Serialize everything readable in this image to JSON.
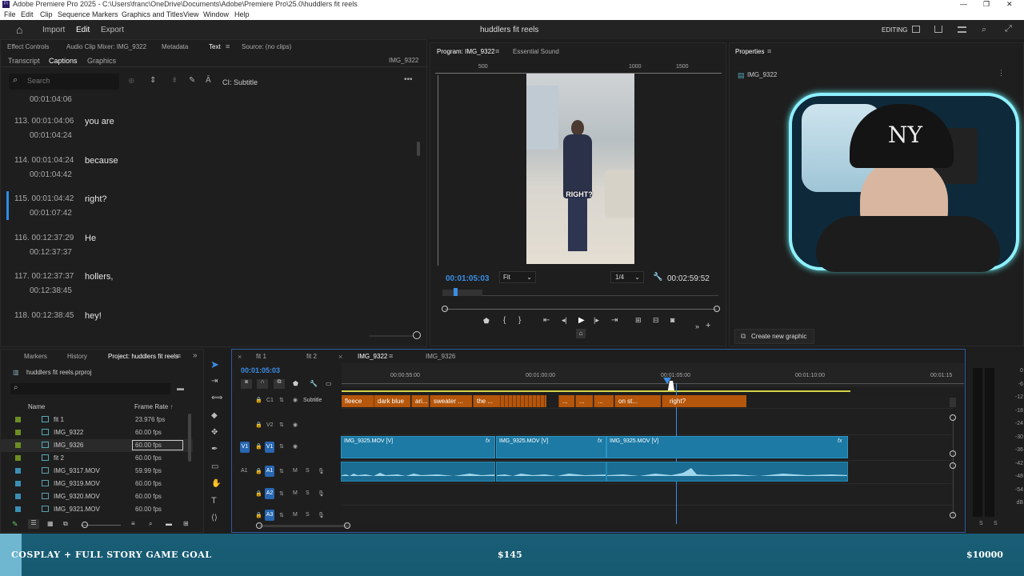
{
  "window": {
    "title": "Adobe Premiere Pro 2025 - C:\\Users\\franc\\OneDrive\\Documents\\Adobe\\Premiere Pro\\25.0\\huddlers fit reels",
    "min": "—",
    "max": "❐",
    "close": "✕"
  },
  "menu": [
    "File",
    "Edit",
    "Clip",
    "Sequence",
    "Markers",
    "Graphics and Titles",
    "View",
    "Window",
    "Help"
  ],
  "header": {
    "home": "⌂",
    "nav": [
      "Import",
      "Edit",
      "Export"
    ],
    "active": "Edit",
    "project_name": "huddlers fit reels",
    "workspace": "EDITING"
  },
  "left_panel": {
    "tabs": [
      "Effect Controls",
      "Audio Clip Mixer: IMG_9322",
      "Metadata",
      "Text",
      "Source: (no clips)"
    ],
    "active_tab": "Text",
    "subtabs": [
      "Transcript",
      "Captions",
      "Graphics"
    ],
    "active_subtab": "Captions",
    "clip_name": "IMG_9322",
    "search_placeholder": "Search",
    "caption_track": "CI: Subtitle",
    "top_timecode": "00:01:04:06",
    "captions": [
      {
        "num": "113.",
        "start": "00:01:04:06",
        "end": "00:01:04:24",
        "text": "you are"
      },
      {
        "num": "114.",
        "start": "00:01:04:24",
        "end": "00:01:04:42",
        "text": "because"
      },
      {
        "num": "115.",
        "start": "00:01:04:42",
        "end": "00:01:07:42",
        "text": "right?",
        "selected": true
      },
      {
        "num": "116.",
        "start": "00:12:37:29",
        "end": "00:12:37:37",
        "text": "He"
      },
      {
        "num": "117.",
        "start": "00:12:37:37",
        "end": "00:12:38:45",
        "text": "hollers,"
      },
      {
        "num": "118.",
        "start": "00:12:38:45",
        "end": "",
        "text": "hey!"
      }
    ]
  },
  "program": {
    "tab": "Program: IMG_9322",
    "tab2": "Essential Sound",
    "ruler": [
      "500",
      "1000",
      "1500"
    ],
    "overlay_text": "RIGHT?",
    "timecode": "00:01:05:03",
    "fit": "Fit",
    "quality": "1/4",
    "duration": "00:02:59:52"
  },
  "properties": {
    "title": "Properties",
    "clip": "IMG_9322",
    "create_graphic": "Create new graphic"
  },
  "project_panel": {
    "tabs": [
      "Markers",
      "History",
      "Project: huddlers fit reels"
    ],
    "active_tab": "Project: huddlers fit reels",
    "file": "huddlers fit reels.prproj",
    "col_name": "Name",
    "col_rate": "Frame Rate",
    "items": [
      {
        "name": "fit 1",
        "rate": "23.976 fps",
        "color": "#6b8e23",
        "kind": "seq"
      },
      {
        "name": "IMG_9322",
        "rate": "60.00 fps",
        "color": "#6b8e23",
        "kind": "seq"
      },
      {
        "name": "IMG_9326",
        "rate": "60.00 fps",
        "color": "#6b8e23",
        "kind": "seq",
        "selected": true
      },
      {
        "name": "fit 2",
        "rate": "60.00 fps",
        "color": "#6b8e23",
        "kind": "seq"
      },
      {
        "name": "IMG_9317.MOV",
        "rate": "59.99 fps",
        "color": "#3a8fb5",
        "kind": "clip"
      },
      {
        "name": "IMG_9319.MOV",
        "rate": "60.00 fps",
        "color": "#3a8fb5",
        "kind": "clip"
      },
      {
        "name": "IMG_9320.MOV",
        "rate": "60.00 fps",
        "color": "#3a8fb5",
        "kind": "clip"
      },
      {
        "name": "IMG_9321.MOV",
        "rate": "60.00 fps",
        "color": "#3a8fb5",
        "kind": "clip"
      }
    ]
  },
  "timeline": {
    "tabs": [
      "fit 1",
      "fit 2",
      "IMG_9322",
      "IMG_9326"
    ],
    "active_tab": "IMG_9322",
    "timecode": "00:01:05:03",
    "ruler": [
      "00:00:55:00",
      "00:01:00:00",
      "00:01:05:00",
      "00:01:10:00",
      "00:01:15"
    ],
    "subtitle_label": "Subtitle",
    "captions": [
      "fleece",
      "dark blue",
      "ari...",
      "sweater ...",
      "the ...",
      "...",
      "...",
      "...",
      "on st...",
      "right?"
    ],
    "tracks": {
      "c1": "C1",
      "v2": "V2",
      "v1": "V1",
      "a1": "A1",
      "a2": "A2",
      "a3": "A3"
    },
    "video_clips": [
      "IMG_9325.MOV [V]",
      "IMG_9325.MOV [V]",
      "IMG_9325.MOV [V]"
    ],
    "meter_labels": [
      "0",
      "-6",
      "-12",
      "-18",
      "-24",
      "-30",
      "-36",
      "-42",
      "-48",
      "-54",
      "dB"
    ],
    "meter_foot": [
      "S",
      "S"
    ]
  },
  "goal_bar": {
    "left": "COSPLAY + FULL STORY GAME GOAL",
    "middle": "$145",
    "right": "$10000"
  }
}
